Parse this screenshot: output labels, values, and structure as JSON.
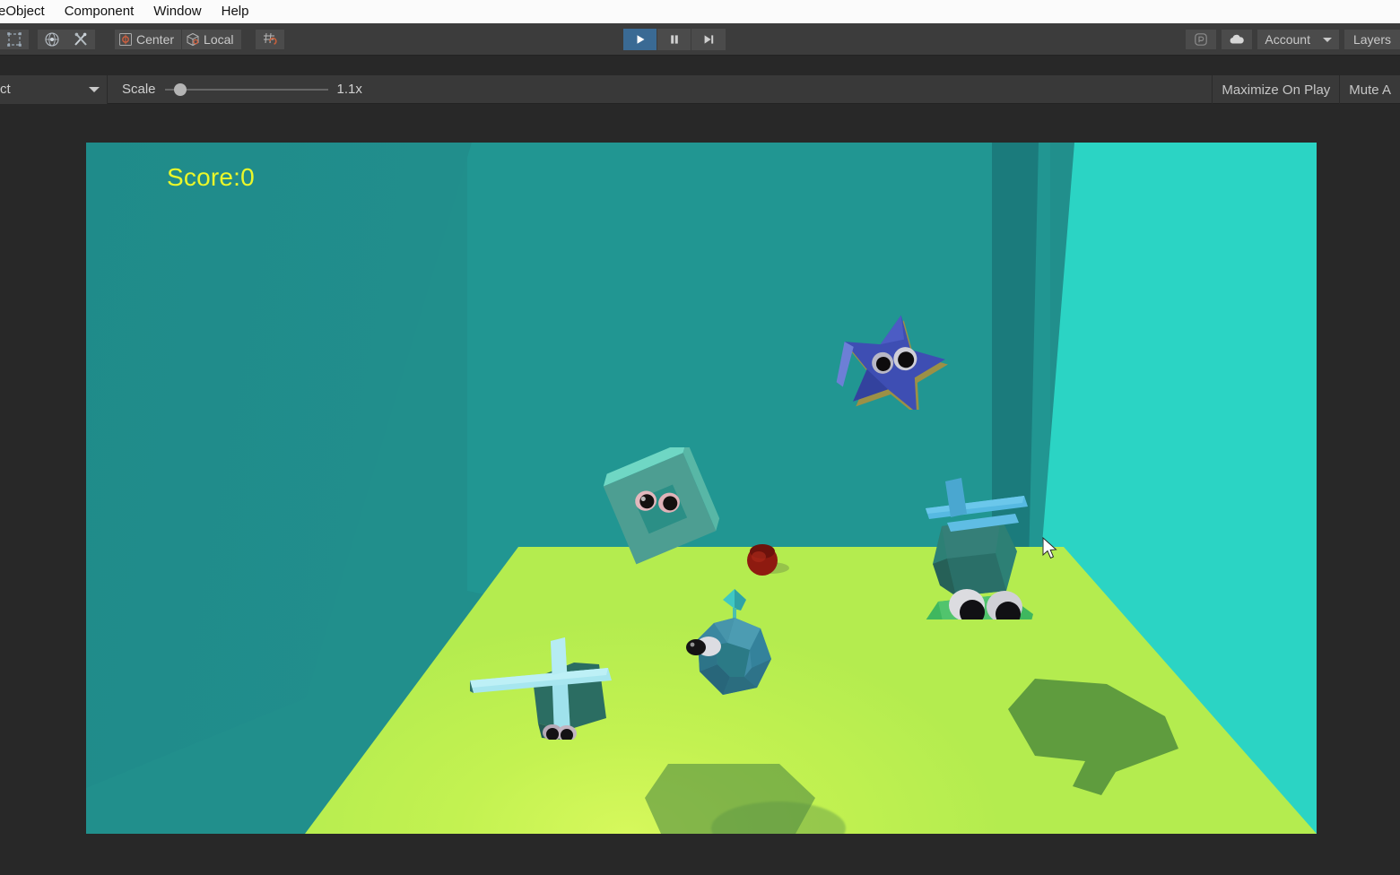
{
  "menubar": {
    "items": [
      {
        "label": "eObject",
        "name": "menu-gameobject"
      },
      {
        "label": "Component",
        "name": "menu-component"
      },
      {
        "label": "Window",
        "name": "menu-window"
      },
      {
        "label": "Help",
        "name": "menu-help"
      }
    ]
  },
  "toolbar": {
    "tools": [
      {
        "name": "rect-transform-tool",
        "icon": "rect-tool-icon"
      },
      {
        "name": "transform-tool",
        "icon": "globe-transform-icon"
      },
      {
        "name": "custom-editor-tool",
        "icon": "wrench-screwdriver-icon"
      }
    ],
    "pivot_mode": "Center",
    "pivot_rotation": "Local",
    "snap_icon": "grid-snap-icon",
    "play_label": "Play",
    "pause_label": "Pause",
    "step_label": "Step",
    "play_active": true,
    "collab_icon": "collab-icon",
    "cloud_icon": "cloud-icon",
    "account_label": "Account",
    "layers_label": "Layers"
  },
  "gamebar": {
    "aspect_value": "ct",
    "scale_label": "Scale",
    "scale_value": "1.1x",
    "scale_percent": 6,
    "maximize_on_play": "Maximize On Play",
    "mute_audio": "Mute A"
  },
  "game": {
    "score_text": "Score:0",
    "score_color": "#eaf72a",
    "colors": {
      "wall_back": "#218f8c",
      "wall_left": "#1f8b8a",
      "wall_right": "#2bd4c4",
      "floor": "#c3f251",
      "shadow": "#4c8a3a"
    },
    "objects": [
      {
        "name": "square-frame-enemy",
        "shape": "square-ring",
        "color": "#4f9e90"
      },
      {
        "name": "star-enemy",
        "shape": "star",
        "color": "#3c4aa8"
      },
      {
        "name": "player-sphere",
        "shape": "icosphere",
        "color": "#3d8ba3"
      },
      {
        "name": "plane-left",
        "shape": "plane",
        "color": "#8fdcea"
      },
      {
        "name": "plane-right",
        "shape": "plane",
        "color": "#5ab6e0"
      },
      {
        "name": "green-rock-enemy",
        "shape": "rock",
        "color": "#3aaa58"
      },
      {
        "name": "red-ball",
        "shape": "sphere",
        "color": "#8e1a10"
      }
    ]
  }
}
